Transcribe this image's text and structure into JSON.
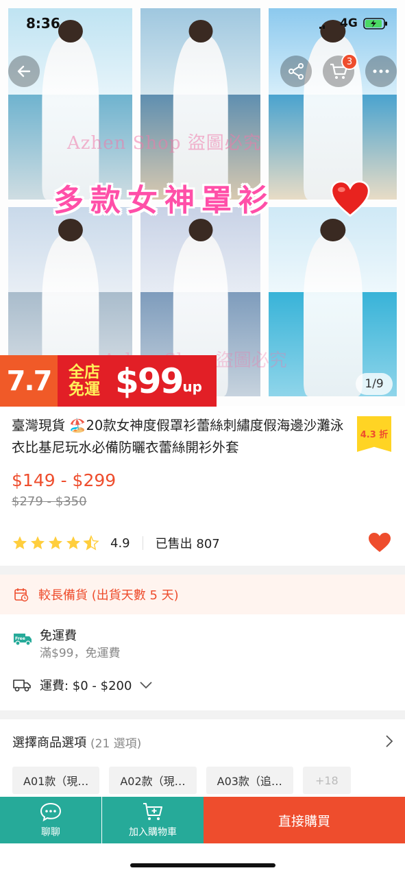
{
  "status_bar": {
    "time": "8:36",
    "network": "4G"
  },
  "gallery": {
    "banner_text": "多款女神罩衫",
    "watermark": "Azhen Shop 盜圖必究",
    "counter": "1/9",
    "cart_badge": "3",
    "icons": [
      "back-arrow-icon",
      "share-icon",
      "cart-icon",
      "more-icon"
    ]
  },
  "promo": {
    "date_logo": "7.7",
    "label_line1": "全店",
    "label_line2": "免運",
    "price": "$99",
    "suffix": "up"
  },
  "product": {
    "title": "臺灣現貨 🏖️20款女神度假罩衫蕾絲刺繡度假海邊沙灘泳衣比基尼玩水必備防曬衣蕾絲開衫外套",
    "discount": "4.3 折",
    "price": "$149 - $299",
    "original_price": "$279 - $350",
    "rating": "4.9",
    "rating_stars": 4.5,
    "sold": "已售出 807"
  },
  "preorder": {
    "text": "較長備貨 (出貨天數 5 天)"
  },
  "shipping": {
    "free_title": "免運費",
    "free_sub": "滿$99，免運費",
    "fee": "運費: $0 - $200"
  },
  "options": {
    "title": "選擇商品選項",
    "count": "(21 選項)",
    "chips": [
      "A01款（現…",
      "A02款（現…",
      "A03款（追…"
    ],
    "more": "+18"
  },
  "bottom_bar": {
    "chat_label": "聊聊",
    "cart_label": "加入購物車",
    "buy_label": "直接購買"
  },
  "colors": {
    "brand_orange": "#ee4d2d",
    "teal": "#26aa99",
    "discount_yellow": "#ffd424",
    "pink_banner": "#ff4fa8"
  }
}
